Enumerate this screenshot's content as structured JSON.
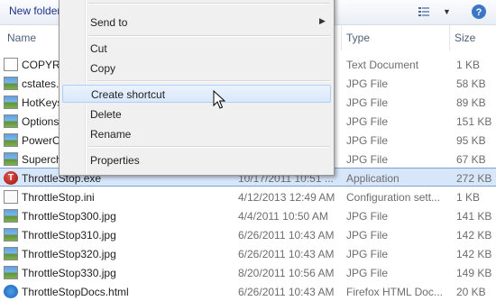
{
  "toolbar": {
    "new_folder": "New folder"
  },
  "columns": {
    "name": "Name",
    "type": "Type",
    "size": "Size"
  },
  "files": [
    {
      "name": "COPYRIGHT.txt",
      "date": "",
      "type": "Text Document",
      "size": "1 KB",
      "icon": "text-document-icon"
    },
    {
      "name": "cstates.jpg",
      "date": "",
      "type": "JPG File",
      "size": "58 KB",
      "icon": "jpg-file-icon"
    },
    {
      "name": "HotKeys.jpg",
      "date": "",
      "type": "JPG File",
      "size": "89 KB",
      "icon": "jpg-file-icon"
    },
    {
      "name": "Options.jpg",
      "date": "",
      "type": "JPG File",
      "size": "151 KB",
      "icon": "jpg-file-icon"
    },
    {
      "name": "PowerOptions.jpg",
      "date": "",
      "type": "JPG File",
      "size": "95 KB",
      "icon": "jpg-file-icon"
    },
    {
      "name": "Supercharger.jpg",
      "date": "",
      "type": "JPG File",
      "size": "67 KB",
      "icon": "jpg-file-icon"
    },
    {
      "name": "ThrottleStop.exe",
      "date": "10/17/2011 10:51 ...",
      "type": "Application",
      "size": "272 KB",
      "icon": "application-icon"
    },
    {
      "name": "ThrottleStop.ini",
      "date": "4/12/2013 12:49 AM",
      "type": "Configuration sett...",
      "size": "1 KB",
      "icon": "ini-file-icon"
    },
    {
      "name": "ThrottleStop300.jpg",
      "date": "4/4/2011 10:50 AM",
      "type": "JPG File",
      "size": "141 KB",
      "icon": "jpg-file-icon"
    },
    {
      "name": "ThrottleStop310.jpg",
      "date": "6/26/2011 10:43 AM",
      "type": "JPG File",
      "size": "142 KB",
      "icon": "jpg-file-icon"
    },
    {
      "name": "ThrottleStop320.jpg",
      "date": "6/26/2011 10:43 AM",
      "type": "JPG File",
      "size": "142 KB",
      "icon": "jpg-file-icon"
    },
    {
      "name": "ThrottleStop330.jpg",
      "date": "8/20/2011 10:56 AM",
      "type": "JPG File",
      "size": "149 KB",
      "icon": "jpg-file-icon"
    },
    {
      "name": "ThrottleStopDocs.html",
      "date": "6/26/2011 10:43 AM",
      "type": "Firefox HTML Doc...",
      "size": "20 KB",
      "icon": "html-file-icon"
    }
  ],
  "context_menu": {
    "send_to": "Send to",
    "cut": "Cut",
    "copy": "Copy",
    "create_shortcut": "Create shortcut",
    "delete": "Delete",
    "rename": "Rename",
    "properties": "Properties"
  }
}
